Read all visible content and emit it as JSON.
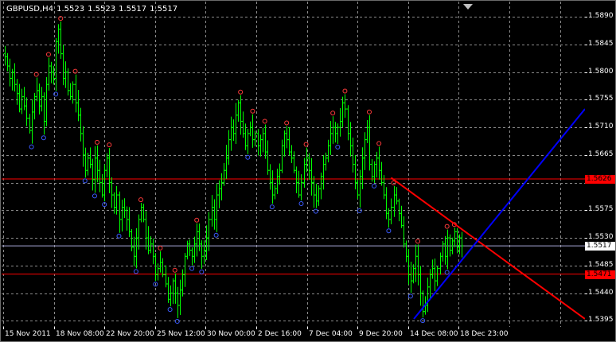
{
  "header": {
    "symbol": "GBPUSD,H4",
    "open": "1.5523",
    "high": "1.5523",
    "low": "1.5517",
    "close": "1.5517"
  },
  "price_axis": {
    "ticks": [
      "1.5890",
      "1.5845",
      "1.5800",
      "1.5755",
      "1.5710",
      "1.5665",
      "1.5620",
      "1.5575",
      "1.5530",
      "1.5485",
      "1.5440",
      "1.5395"
    ],
    "tick_values": [
      1.589,
      1.5845,
      1.58,
      1.5755,
      1.571,
      1.5665,
      1.562,
      1.5575,
      1.553,
      1.5485,
      1.544,
      1.5395
    ],
    "current_price": "1.5517",
    "resistance_level": "1.5626",
    "support_level": "1.5471"
  },
  "time_axis": {
    "labels": [
      "15 Nov 2011",
      "18 Nov 08:00",
      "22 Nov 20:00",
      "25 Nov 12:00",
      "30 Nov 00:00",
      "2 Dec 16:00",
      "7 Dec 04:00",
      "9 Dec 20:00",
      "14 Dec 08:00",
      "18 Dec 23:00"
    ]
  },
  "colors": {
    "background": "#000000",
    "grid": "#8a8a8a",
    "bars": "#00ff00",
    "fractal_marker": "#ff3b3b",
    "fractal_marker_low": "#3a5bff",
    "horizontal_level": "#ff0000",
    "current_price_line": "#a8a8d8",
    "downtrend_line": "#ff0000",
    "uptrend_line": "#0000ff",
    "text": "#ffffff"
  },
  "chart_data": {
    "type": "ohlc",
    "series_name": "GBPUSD,H4",
    "ylim": [
      1.5385,
      1.5915
    ],
    "grid": true,
    "close_path": [
      1.5825,
      1.581,
      1.579,
      1.58,
      1.578,
      1.5765,
      1.574,
      1.576,
      1.5745,
      1.5725,
      1.5705,
      1.5735,
      1.576,
      1.577,
      1.5745,
      1.576,
      1.572,
      1.578,
      1.581,
      1.58,
      1.579,
      1.585,
      1.587,
      1.583,
      1.579,
      1.58,
      1.577,
      1.576,
      1.578,
      1.575,
      1.573,
      1.57,
      1.5665,
      1.564,
      1.566,
      1.565,
      1.5625,
      1.566,
      1.564,
      1.562,
      1.56,
      1.564,
      1.566,
      1.562,
      1.56,
      1.558,
      1.56,
      1.556,
      1.558,
      1.5575,
      1.556,
      1.554,
      1.5515,
      1.55,
      1.553,
      1.556,
      1.558,
      1.556,
      1.553,
      1.551,
      1.552,
      1.55,
      1.547,
      1.548,
      1.549,
      1.547,
      1.5455,
      1.543,
      1.544,
      1.546,
      1.544,
      1.542,
      1.5445,
      1.547,
      1.55,
      1.552,
      1.551,
      1.55,
      1.552,
      1.554,
      1.552,
      1.55,
      1.551,
      1.553,
      1.556,
      1.558,
      1.556,
      1.56,
      1.561,
      1.562,
      1.564,
      1.566,
      1.569,
      1.571,
      1.57,
      1.573,
      1.575,
      1.572,
      1.57,
      1.568,
      1.57,
      1.571,
      1.569,
      1.57,
      1.568,
      1.569,
      1.57,
      1.567,
      1.564,
      1.562,
      1.56,
      1.561,
      1.563,
      1.564,
      1.568,
      1.57,
      1.569,
      1.567,
      1.566,
      1.564,
      1.562,
      1.56,
      1.562,
      1.565,
      1.566,
      1.564,
      1.562,
      1.56,
      1.559,
      1.561,
      1.563,
      1.565,
      1.566,
      1.568,
      1.57,
      1.571,
      1.57,
      1.571,
      1.572,
      1.575,
      1.574,
      1.57,
      1.568,
      1.565,
      1.562,
      1.56,
      1.563,
      1.566,
      1.569,
      1.571,
      1.565,
      1.563,
      1.565,
      1.566,
      1.564,
      1.562,
      1.56,
      1.557,
      1.556,
      1.558,
      1.56,
      1.559,
      1.557,
      1.555,
      1.552,
      1.55,
      1.547,
      1.546,
      1.548,
      1.55,
      1.547,
      1.544,
      1.541,
      1.542,
      1.545,
      1.547,
      1.548,
      1.546,
      1.548,
      1.55,
      1.552,
      1.55,
      1.553,
      1.551,
      1.5525,
      1.554,
      1.5515,
      1.553,
      1.5517
    ]
  }
}
